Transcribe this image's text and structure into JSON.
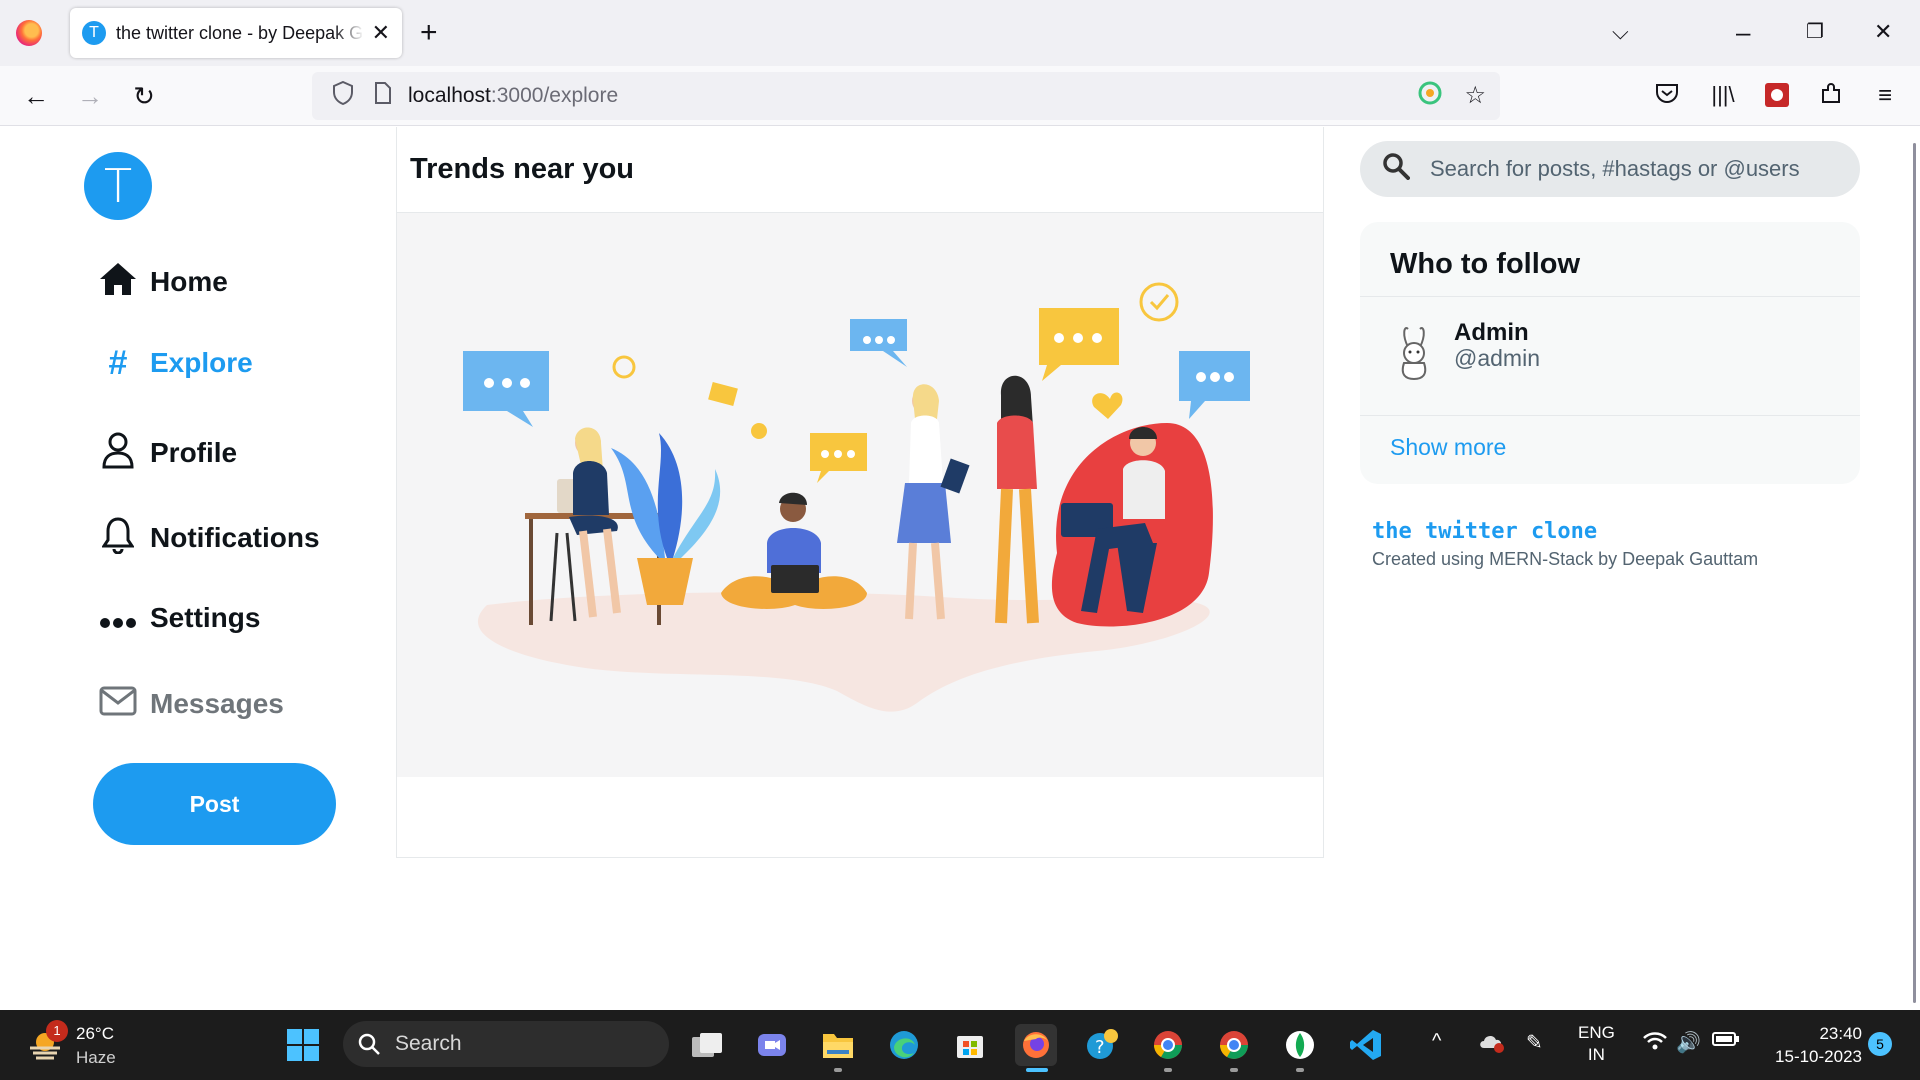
{
  "browser": {
    "tab_title": "the twitter clone - by Deepak Gauttam",
    "tab_favicon_letter": "T",
    "url_host": "localhost",
    "url_path": ":3000/explore"
  },
  "app": {
    "logo_letter": "T",
    "nav": [
      {
        "label": "Home",
        "icon": "home-icon"
      },
      {
        "label": "Explore",
        "icon": "hashtag-icon"
      },
      {
        "label": "Profile",
        "icon": "user-icon"
      },
      {
        "label": "Notifications",
        "icon": "bell-icon"
      },
      {
        "label": "Settings",
        "icon": "more-icon"
      },
      {
        "label": "Messages",
        "icon": "envelope-icon"
      }
    ],
    "post_button": "Post",
    "trends_title": "Trends near you",
    "search_placeholder": "Search for posts, #hastags or @users",
    "who_to_follow": {
      "title": "Who to follow",
      "users": [
        {
          "name": "Admin",
          "handle": "@admin"
        }
      ],
      "show_more": "Show more"
    },
    "footer": {
      "title": "the twitter clone",
      "subtitle": "Created using MERN-Stack by Deepak Gauttam"
    },
    "accent_color": "#1d9bf0"
  },
  "taskbar": {
    "weather_temp": "26°C",
    "weather_cond": "Haze",
    "weather_badge": "1",
    "search_label": "Search",
    "lang_top": "ENG",
    "lang_bottom": "IN",
    "time": "23:40",
    "date": "15-10-2023",
    "notification_count": "5"
  }
}
